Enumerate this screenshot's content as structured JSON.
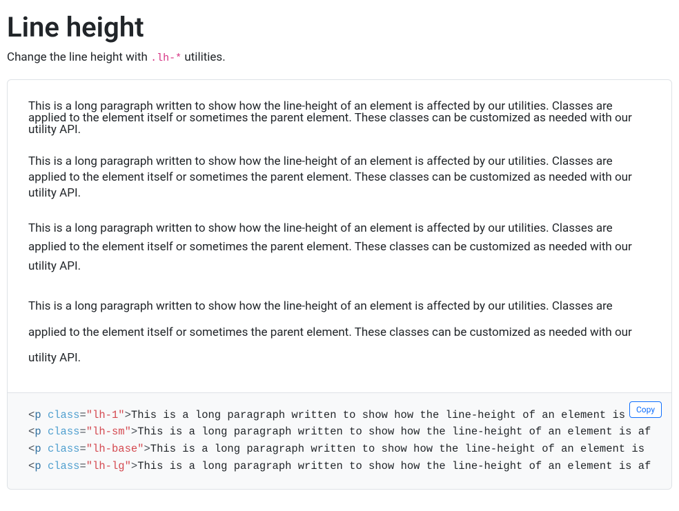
{
  "title": "Line height",
  "lead_before": "Change the line height with ",
  "lead_code": ".lh-*",
  "lead_after": " utilities.",
  "sample_paragraph": "This is a long paragraph written to show how the line-height of an element is affected by our utilities. Classes are applied to the element itself or sometimes the parent element. These classes can be customized as needed with our utility API.",
  "copy_label": "Copy",
  "code": {
    "tag_open": "<",
    "tag_name": "p",
    "space": " ",
    "attr_name": "class",
    "eq": "=",
    "q": "\"",
    "gt": ">",
    "classes": [
      "lh-1",
      "lh-sm",
      "lh-base",
      "lh-lg"
    ],
    "text_after": "This is a long paragraph written to show how the line-height of an element is affected by our utilities. Classes are applied to the element itself or sometimes the parent element. These classes can be customized as needed with our utility API."
  }
}
